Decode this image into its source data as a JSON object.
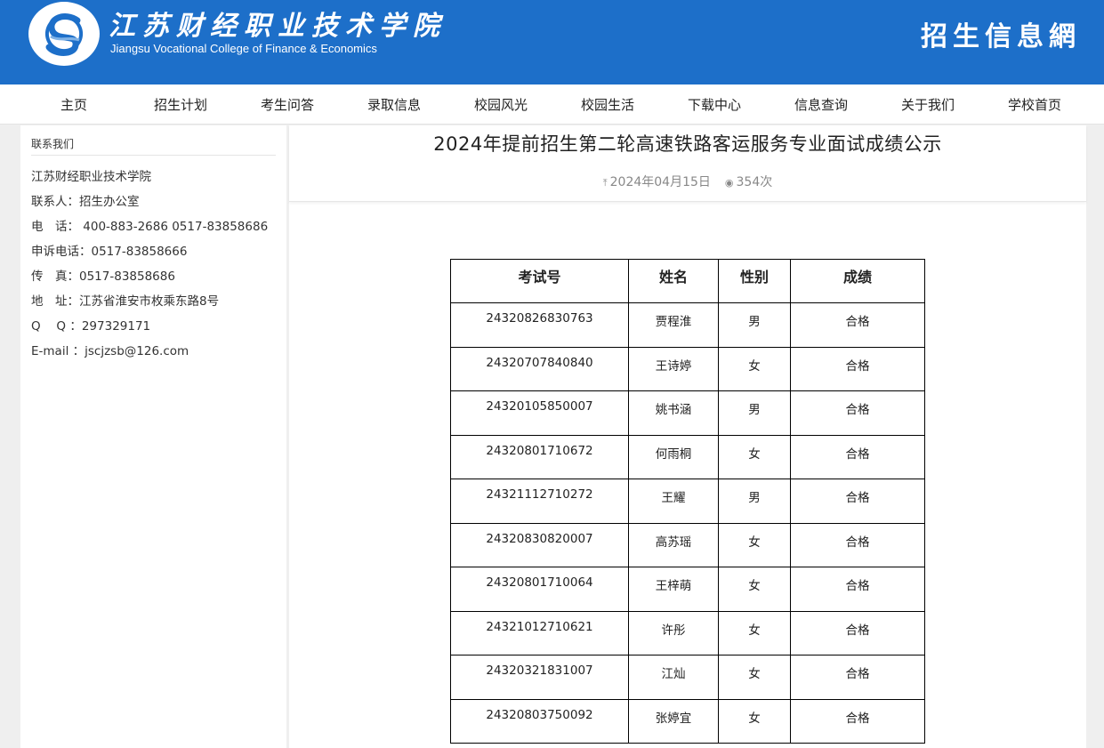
{
  "header": {
    "logo_cn": "江苏财经职业技术学院",
    "logo_en": "Jiangsu Vocational College of Finance & Economics",
    "site_title": "招生信息網"
  },
  "nav": [
    "主页",
    "招生计划",
    "考生问答",
    "录取信息",
    "校园风光",
    "校园生活",
    "下载中心",
    "信息查询",
    "关于我们",
    "学校首页"
  ],
  "sidebar": {
    "title": "联系我们",
    "lines": [
      "江苏财经职业技术学院",
      "联系人：招生办公室",
      "电　话： 400-883-2686 0517-83858686",
      "申诉电话：0517-83858666",
      "传　真：0517-83858686",
      "地　址：江苏省淮安市枚乘东路8号",
      "Q　 Q ：297329171",
      "E-mail ：jscjzsb@126.com"
    ]
  },
  "article": {
    "title": "2024年提前招生第二轮高速铁路客运服务专业面试成绩公示",
    "date": "2024年04月15日",
    "views": "354次"
  },
  "table": {
    "headers": [
      "考试号",
      "姓名",
      "性别",
      "成绩"
    ],
    "rows": [
      [
        "24320826830763",
        "贾程淮",
        "男",
        "合格"
      ],
      [
        "24320707840840",
        "王诗婷",
        "女",
        "合格"
      ],
      [
        "24320105850007",
        "姚书涵",
        "男",
        "合格"
      ],
      [
        "24320801710672",
        "何雨桐",
        "女",
        "合格"
      ],
      [
        "24321112710272",
        "王耀",
        "男",
        "合格"
      ],
      [
        "24320830820007",
        "高苏瑶",
        "女",
        "合格"
      ],
      [
        "24320801710064",
        "王梓萌",
        "女",
        "合格"
      ],
      [
        "24321012710621",
        "许彤",
        "女",
        "合格"
      ],
      [
        "24320321831007",
        "江灿",
        "女",
        "合格"
      ],
      [
        "24320803750092",
        "张婷宜",
        "女",
        "合格"
      ]
    ]
  }
}
